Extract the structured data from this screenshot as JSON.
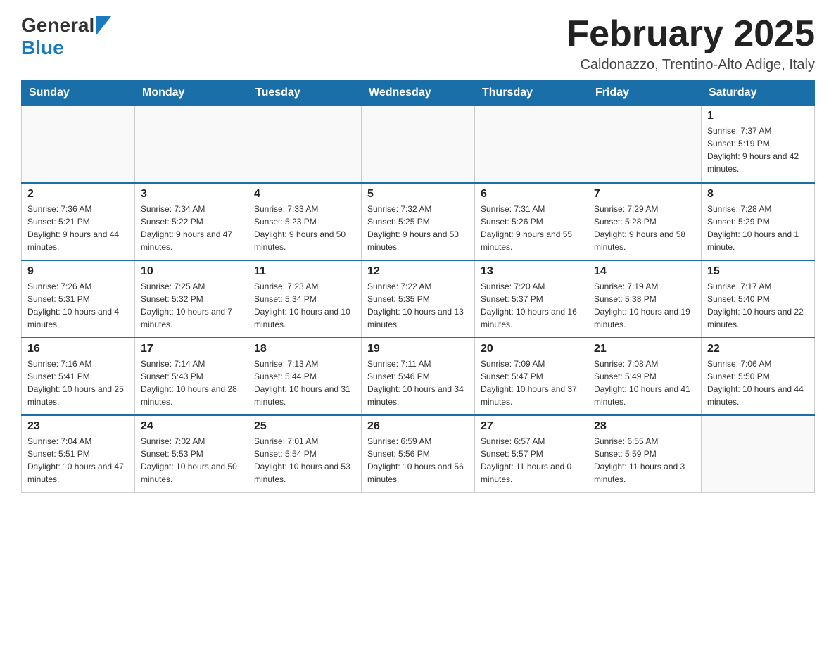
{
  "header": {
    "logo_general": "General",
    "logo_blue": "Blue",
    "title": "February 2025",
    "location": "Caldonazzo, Trentino-Alto Adige, Italy"
  },
  "weekdays": [
    "Sunday",
    "Monday",
    "Tuesday",
    "Wednesday",
    "Thursday",
    "Friday",
    "Saturday"
  ],
  "weeks": [
    [
      {
        "day": "",
        "info": ""
      },
      {
        "day": "",
        "info": ""
      },
      {
        "day": "",
        "info": ""
      },
      {
        "day": "",
        "info": ""
      },
      {
        "day": "",
        "info": ""
      },
      {
        "day": "",
        "info": ""
      },
      {
        "day": "1",
        "info": "Sunrise: 7:37 AM\nSunset: 5:19 PM\nDaylight: 9 hours and 42 minutes."
      }
    ],
    [
      {
        "day": "2",
        "info": "Sunrise: 7:36 AM\nSunset: 5:21 PM\nDaylight: 9 hours and 44 minutes."
      },
      {
        "day": "3",
        "info": "Sunrise: 7:34 AM\nSunset: 5:22 PM\nDaylight: 9 hours and 47 minutes."
      },
      {
        "day": "4",
        "info": "Sunrise: 7:33 AM\nSunset: 5:23 PM\nDaylight: 9 hours and 50 minutes."
      },
      {
        "day": "5",
        "info": "Sunrise: 7:32 AM\nSunset: 5:25 PM\nDaylight: 9 hours and 53 minutes."
      },
      {
        "day": "6",
        "info": "Sunrise: 7:31 AM\nSunset: 5:26 PM\nDaylight: 9 hours and 55 minutes."
      },
      {
        "day": "7",
        "info": "Sunrise: 7:29 AM\nSunset: 5:28 PM\nDaylight: 9 hours and 58 minutes."
      },
      {
        "day": "8",
        "info": "Sunrise: 7:28 AM\nSunset: 5:29 PM\nDaylight: 10 hours and 1 minute."
      }
    ],
    [
      {
        "day": "9",
        "info": "Sunrise: 7:26 AM\nSunset: 5:31 PM\nDaylight: 10 hours and 4 minutes."
      },
      {
        "day": "10",
        "info": "Sunrise: 7:25 AM\nSunset: 5:32 PM\nDaylight: 10 hours and 7 minutes."
      },
      {
        "day": "11",
        "info": "Sunrise: 7:23 AM\nSunset: 5:34 PM\nDaylight: 10 hours and 10 minutes."
      },
      {
        "day": "12",
        "info": "Sunrise: 7:22 AM\nSunset: 5:35 PM\nDaylight: 10 hours and 13 minutes."
      },
      {
        "day": "13",
        "info": "Sunrise: 7:20 AM\nSunset: 5:37 PM\nDaylight: 10 hours and 16 minutes."
      },
      {
        "day": "14",
        "info": "Sunrise: 7:19 AM\nSunset: 5:38 PM\nDaylight: 10 hours and 19 minutes."
      },
      {
        "day": "15",
        "info": "Sunrise: 7:17 AM\nSunset: 5:40 PM\nDaylight: 10 hours and 22 minutes."
      }
    ],
    [
      {
        "day": "16",
        "info": "Sunrise: 7:16 AM\nSunset: 5:41 PM\nDaylight: 10 hours and 25 minutes."
      },
      {
        "day": "17",
        "info": "Sunrise: 7:14 AM\nSunset: 5:43 PM\nDaylight: 10 hours and 28 minutes."
      },
      {
        "day": "18",
        "info": "Sunrise: 7:13 AM\nSunset: 5:44 PM\nDaylight: 10 hours and 31 minutes."
      },
      {
        "day": "19",
        "info": "Sunrise: 7:11 AM\nSunset: 5:46 PM\nDaylight: 10 hours and 34 minutes."
      },
      {
        "day": "20",
        "info": "Sunrise: 7:09 AM\nSunset: 5:47 PM\nDaylight: 10 hours and 37 minutes."
      },
      {
        "day": "21",
        "info": "Sunrise: 7:08 AM\nSunset: 5:49 PM\nDaylight: 10 hours and 41 minutes."
      },
      {
        "day": "22",
        "info": "Sunrise: 7:06 AM\nSunset: 5:50 PM\nDaylight: 10 hours and 44 minutes."
      }
    ],
    [
      {
        "day": "23",
        "info": "Sunrise: 7:04 AM\nSunset: 5:51 PM\nDaylight: 10 hours and 47 minutes."
      },
      {
        "day": "24",
        "info": "Sunrise: 7:02 AM\nSunset: 5:53 PM\nDaylight: 10 hours and 50 minutes."
      },
      {
        "day": "25",
        "info": "Sunrise: 7:01 AM\nSunset: 5:54 PM\nDaylight: 10 hours and 53 minutes."
      },
      {
        "day": "26",
        "info": "Sunrise: 6:59 AM\nSunset: 5:56 PM\nDaylight: 10 hours and 56 minutes."
      },
      {
        "day": "27",
        "info": "Sunrise: 6:57 AM\nSunset: 5:57 PM\nDaylight: 11 hours and 0 minutes."
      },
      {
        "day": "28",
        "info": "Sunrise: 6:55 AM\nSunset: 5:59 PM\nDaylight: 11 hours and 3 minutes."
      },
      {
        "day": "",
        "info": ""
      }
    ]
  ]
}
